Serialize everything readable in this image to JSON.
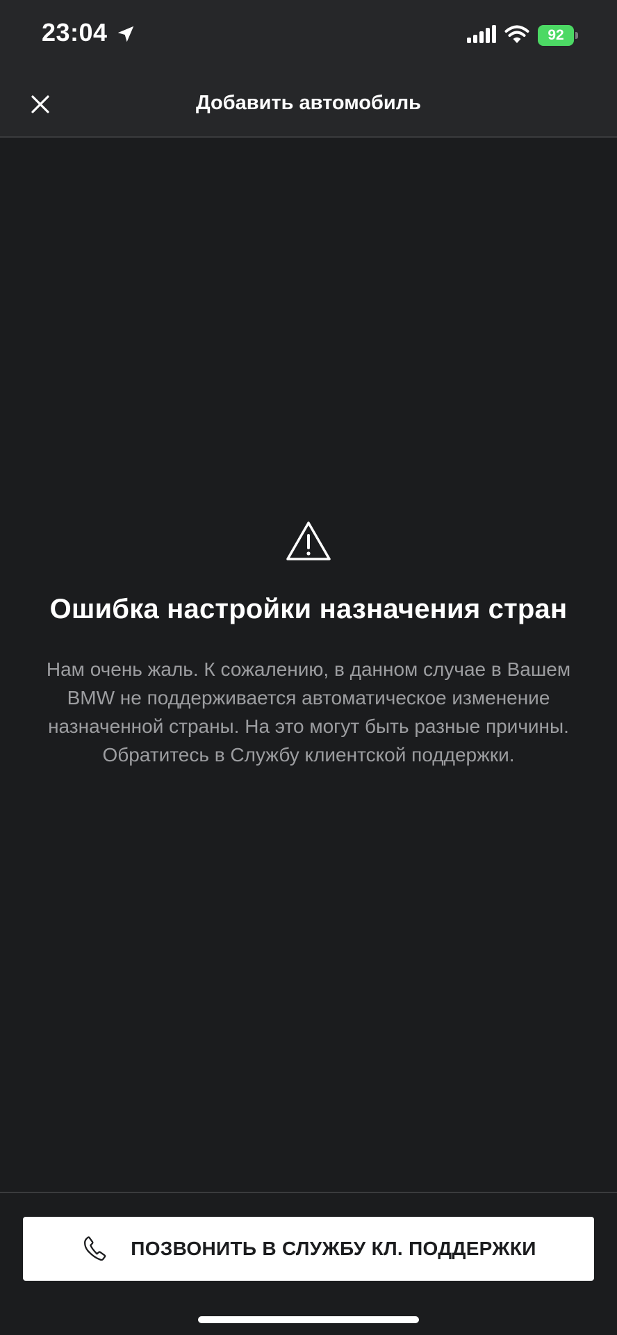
{
  "status_bar": {
    "time": "23:04",
    "battery": "92",
    "icons": [
      "location-arrow-icon",
      "cellular-signal-icon",
      "wifi-icon",
      "battery-charging-icon"
    ]
  },
  "header": {
    "title": "Добавить автомобиль",
    "close_icon": "close-icon"
  },
  "error": {
    "icon": "warning-icon",
    "title": "Ошибка настройки назначения стран",
    "message": "Нам очень жаль. К сожалению, в данном случае в Вашем BMW не поддерживается автоматическое изменение назначенной страны. На это могут быть разные причины. Обратитесь в Службу клиентской поддержки."
  },
  "actions": {
    "call_label": "ПОЗВОНИТЬ В СЛУЖБУ КЛ. ПОДДЕРЖКИ",
    "call_icon": "phone-icon"
  },
  "colors": {
    "background": "#1b1c1e",
    "header_background": "#262729",
    "battery_green": "#4cd964",
    "body_text": "#9c9da0",
    "button_background": "#ffffff"
  }
}
